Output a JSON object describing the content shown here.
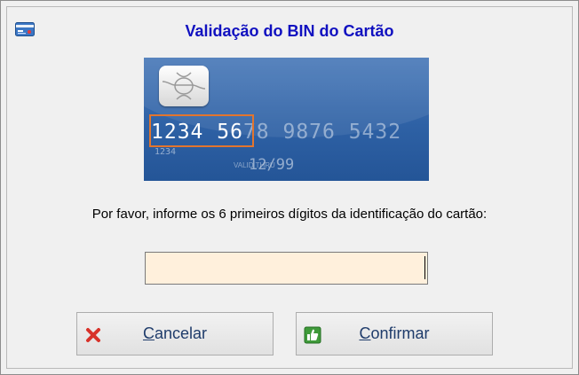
{
  "dialog": {
    "title": "Validação do BIN do Cartão",
    "prompt": "Por favor, informe os 6 primeiros dígitos da identificação do cartão:",
    "bin_input": {
      "value": "",
      "placeholder": ""
    }
  },
  "card_illustration": {
    "bin_digits": "1234 56",
    "rest_digits": "78 9876 5432",
    "small_number": "1234",
    "expiry_label": "VALID THRU",
    "expiry": "12/99"
  },
  "buttons": {
    "cancel": {
      "mnemonic": "C",
      "rest": "ancelar",
      "icon": "x-icon"
    },
    "confirm": {
      "mnemonic": "C",
      "rest": "onfirmar",
      "icon": "thumbs-up-icon"
    }
  },
  "colors": {
    "title": "#1010c0",
    "input_bg": "#fff0dc",
    "highlight": "#e2752e"
  }
}
